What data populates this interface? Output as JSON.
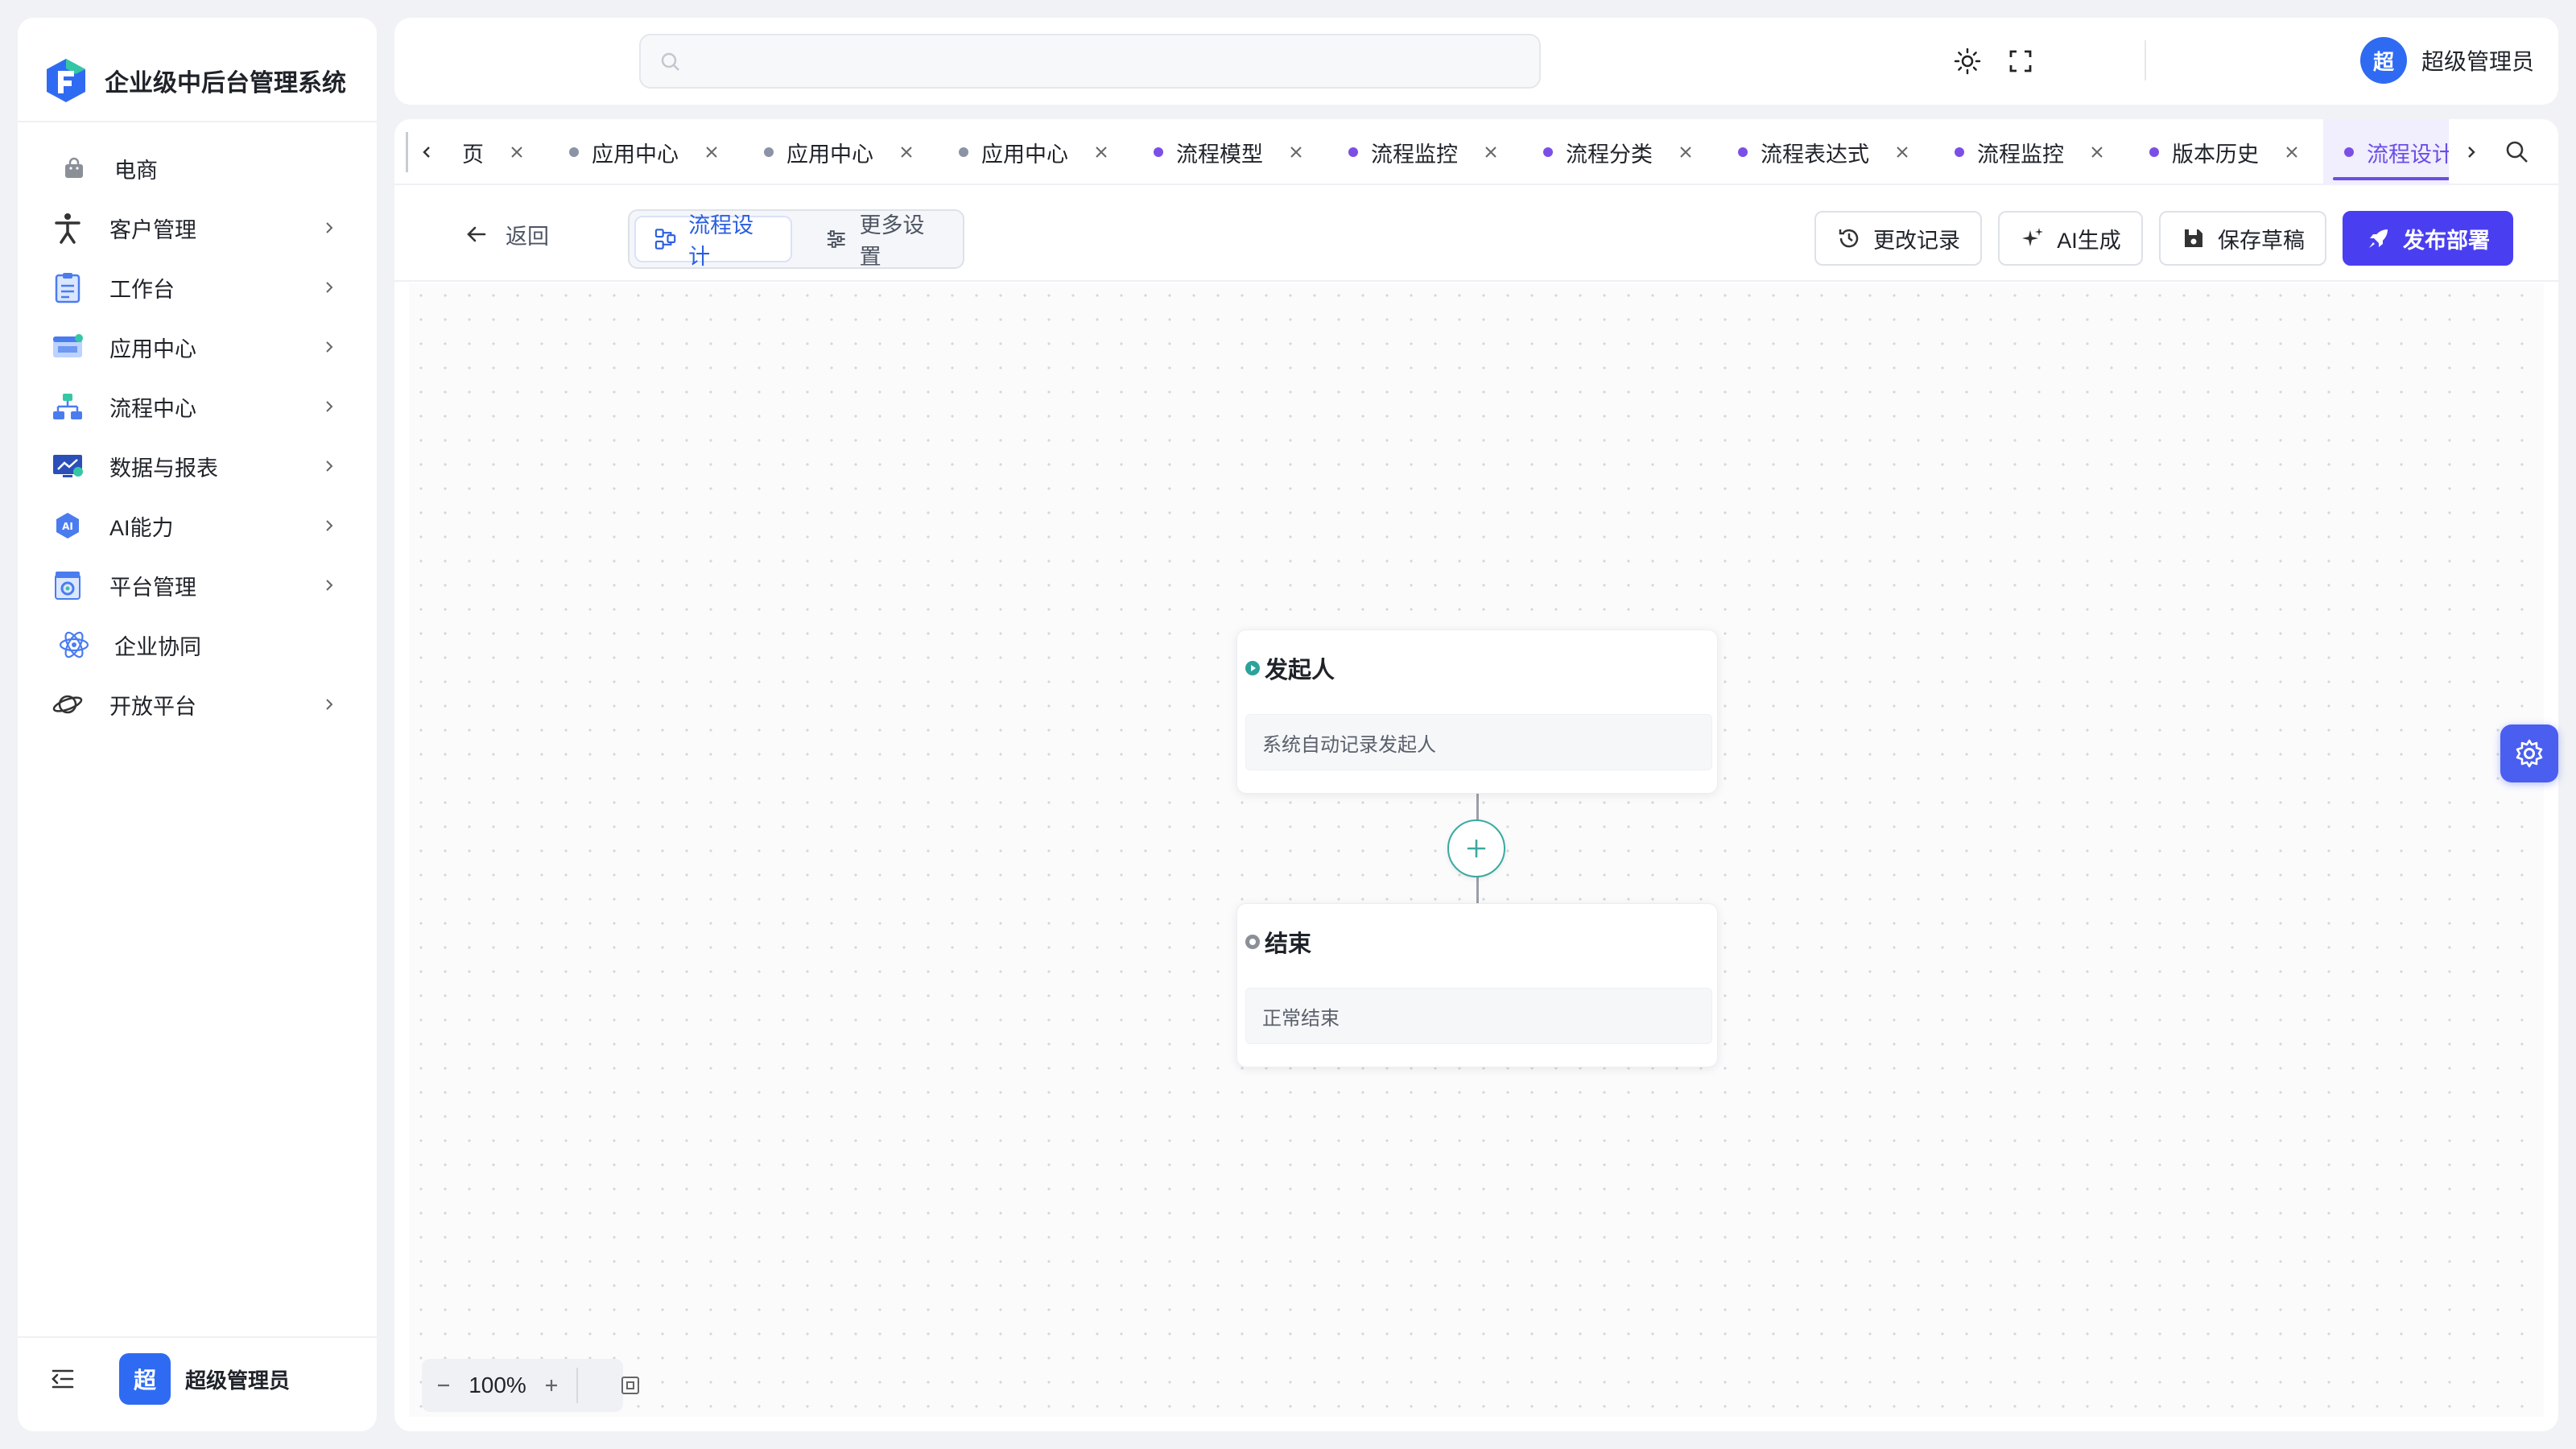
{
  "app": {
    "title": "企业级中后台管理系统"
  },
  "sidebar": {
    "items": [
      {
        "label": "电商",
        "icon": "shopping-bag-icon",
        "has_children": false
      },
      {
        "label": "客户管理",
        "icon": "person-icon",
        "has_children": true
      },
      {
        "label": "工作台",
        "icon": "clipboard-icon",
        "has_children": true
      },
      {
        "label": "应用中心",
        "icon": "app-window-icon",
        "has_children": true
      },
      {
        "label": "流程中心",
        "icon": "flow-icon",
        "has_children": true
      },
      {
        "label": "数据与报表",
        "icon": "report-icon",
        "has_children": true
      },
      {
        "label": "AI能力",
        "icon": "ai-icon",
        "has_children": true
      },
      {
        "label": "平台管理",
        "icon": "platform-icon",
        "has_children": true
      },
      {
        "label": "企业协同",
        "icon": "atom-icon",
        "has_children": false
      },
      {
        "label": "开放平台",
        "icon": "planet-icon",
        "has_children": true
      }
    ],
    "footer": {
      "avatar_text": "超",
      "user_name": "超级管理员"
    }
  },
  "header": {
    "search": {
      "placeholder": ""
    },
    "user": {
      "avatar_text": "超",
      "name": "超级管理员"
    }
  },
  "tabs": [
    {
      "label": "页",
      "dot_color": "",
      "active": false
    },
    {
      "label": "应用中心",
      "dot_color": "#8a94a6",
      "active": false
    },
    {
      "label": "应用中心",
      "dot_color": "#8a94a6",
      "active": false
    },
    {
      "label": "应用中心",
      "dot_color": "#8a94a6",
      "active": false
    },
    {
      "label": "流程模型",
      "dot_color": "#7b4fe6",
      "active": false
    },
    {
      "label": "流程监控",
      "dot_color": "#7b4fe6",
      "active": false
    },
    {
      "label": "流程分类",
      "dot_color": "#7b4fe6",
      "active": false
    },
    {
      "label": "流程表达式",
      "dot_color": "#7b4fe6",
      "active": false
    },
    {
      "label": "流程监控",
      "dot_color": "#7b4fe6",
      "active": false
    },
    {
      "label": "版本历史",
      "dot_color": "#7b4fe6",
      "active": false
    },
    {
      "label": "流程设计",
      "dot_color": "#7b4fe6",
      "active": true
    }
  ],
  "toolbar": {
    "back_label": "返回",
    "segments": {
      "design_label": "流程设计",
      "settings_label": "更多设置",
      "active": "design"
    },
    "history_label": "更改记录",
    "ai_label": "AI生成",
    "save_label": "保存草稿",
    "publish_label": "发布部署"
  },
  "flow": {
    "start_node": {
      "title": "发起人",
      "desc": "系统自动记录发起人",
      "dot_color": "#2aa39a"
    },
    "end_node": {
      "title": "结束",
      "desc": "正常结束",
      "dot_color": "#8a8f98"
    }
  },
  "canvas_controls": {
    "zoom": "100%"
  },
  "colors": {
    "primary": "#2f6bf2",
    "accent_purple": "#6b4ee6",
    "publish": "#4a3ff0",
    "teal": "#3aa9a0"
  }
}
